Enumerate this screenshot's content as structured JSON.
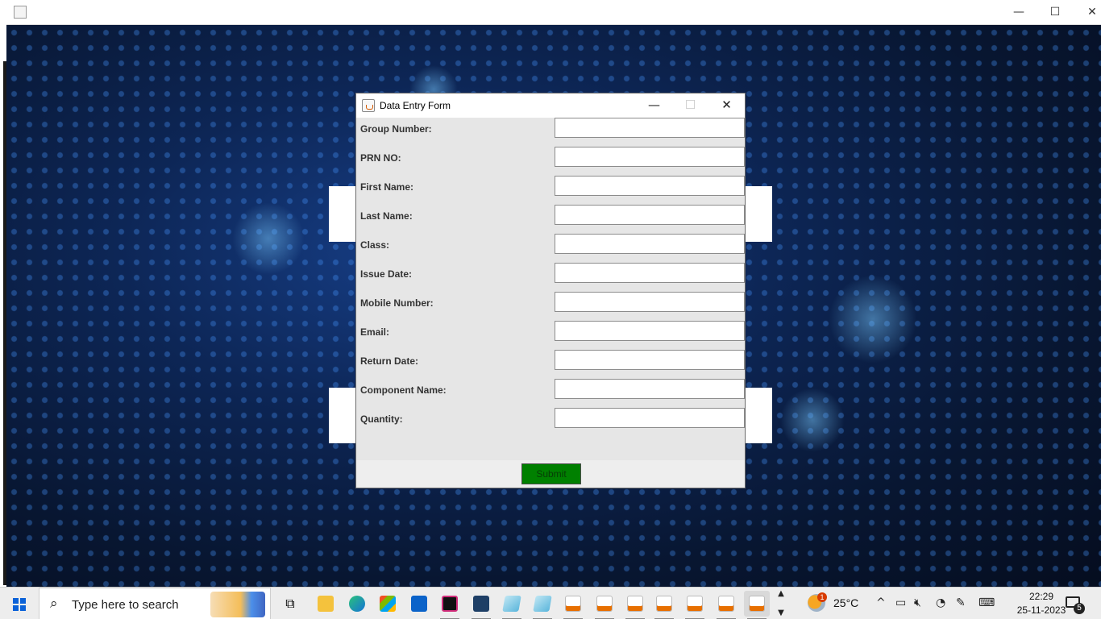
{
  "dialog": {
    "title": "Data Entry Form",
    "fields": [
      {
        "label": "Group Number:",
        "value": ""
      },
      {
        "label": "PRN NO:",
        "value": ""
      },
      {
        "label": "First Name:",
        "value": ""
      },
      {
        "label": "Last Name:",
        "value": ""
      },
      {
        "label": "Class:",
        "value": ""
      },
      {
        "label": "Issue Date:",
        "value": ""
      },
      {
        "label": "Mobile Number:",
        "value": ""
      },
      {
        "label": "Email:",
        "value": ""
      },
      {
        "label": "Return Date:",
        "value": ""
      },
      {
        "label": "Component Name:",
        "value": ""
      },
      {
        "label": "Quantity:",
        "value": ""
      }
    ],
    "submit_label": "Submit",
    "colors": {
      "submit_bg": "#008000"
    }
  },
  "taskbar": {
    "search_placeholder": "Type here to search",
    "weather": "25°C",
    "weather_badge": "1",
    "time": "22:29",
    "date": "25-11-2023",
    "notification_count": "5",
    "pinned_icons": [
      "task-view-icon",
      "file-explorer-icon",
      "edge-icon",
      "microsoft-store-icon",
      "mail-icon",
      "intellij-icon",
      "mysql-workbench-icon",
      "notepad-icon",
      "notepad-icon",
      "java-icon",
      "java-icon",
      "java-icon",
      "java-icon",
      "java-icon",
      "java-icon",
      "java-icon"
    ]
  }
}
